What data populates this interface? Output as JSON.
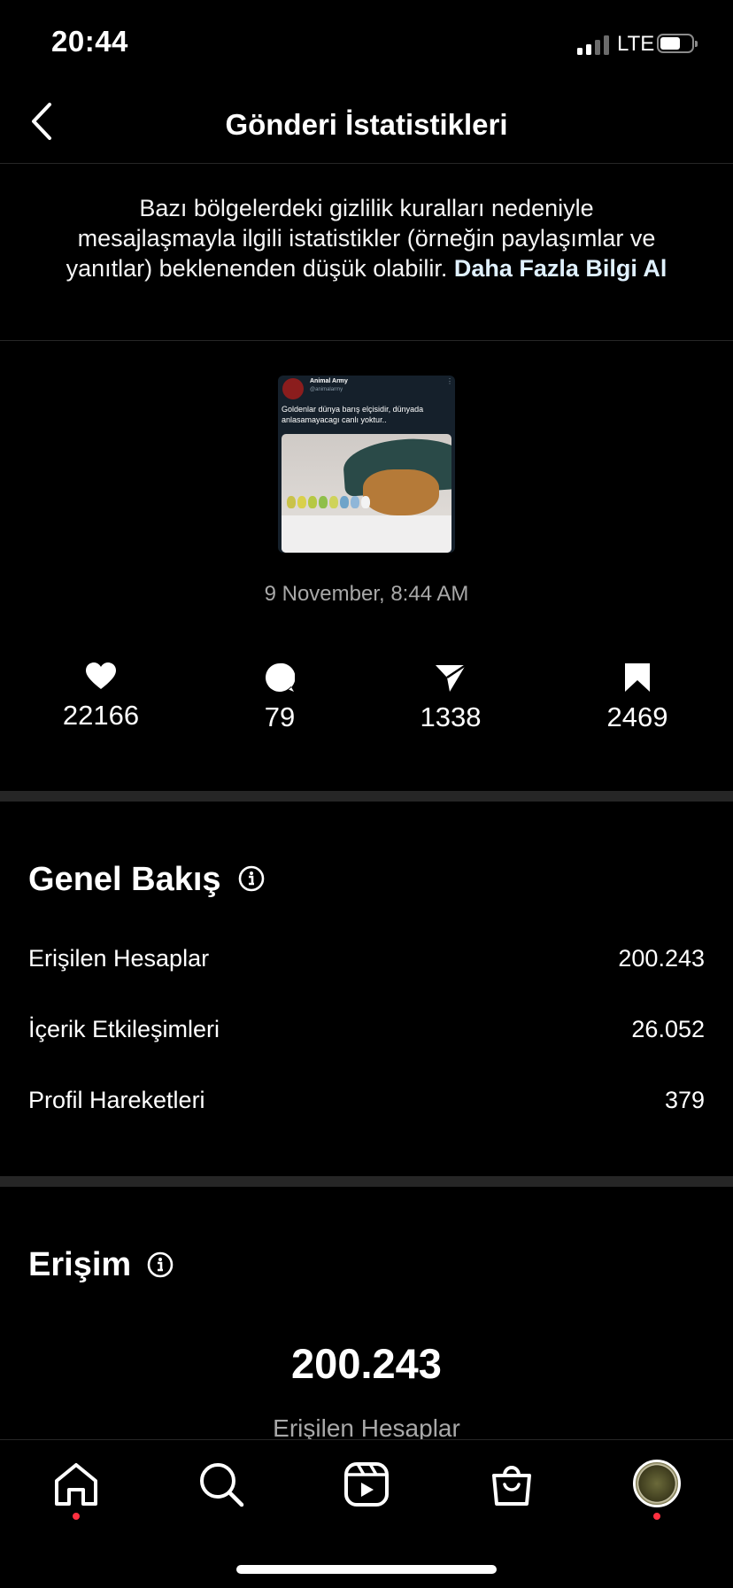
{
  "status_bar": {
    "time": "20:44",
    "network": "LTE"
  },
  "header": {
    "title": "Gönderi İstatistikleri"
  },
  "notice": {
    "text": "Bazı bölgelerdeki gizlilik kuralları nedeniyle mesajlaşmayla ilgili istatistikler (örneğin paylaşımlar ve yanıtlar) beklenenden düşük olabilir.",
    "link": "Daha Fazla Bilgi Al"
  },
  "post": {
    "tweet_name": "Animal Army",
    "tweet_handle": "@animalarmy",
    "tweet_text": "Goldenlar dünya barış elçisidir, dünyada anlasamayacagı canlı yoktur..",
    "date": "9 November, 8:44 AM"
  },
  "stats": {
    "likes": "22166",
    "comments": "79",
    "shares": "1338",
    "saves": "2469"
  },
  "overview": {
    "title": "Genel Bakış",
    "rows": [
      {
        "label": "Erişilen Hesaplar",
        "value": "200.243"
      },
      {
        "label": "İçerik Etkileşimleri",
        "value": "26.052"
      },
      {
        "label": "Profil Hareketleri",
        "value": "379"
      }
    ]
  },
  "reach": {
    "title": "Erişim",
    "value": "200.243",
    "label": "Erişilen Hesaplar"
  },
  "colors": {
    "notification_dot": "#ff3040",
    "link": "#e0f1ff",
    "divider": "#262626"
  },
  "icons": [
    "home-icon",
    "search-icon",
    "reels-icon",
    "shop-icon"
  ]
}
